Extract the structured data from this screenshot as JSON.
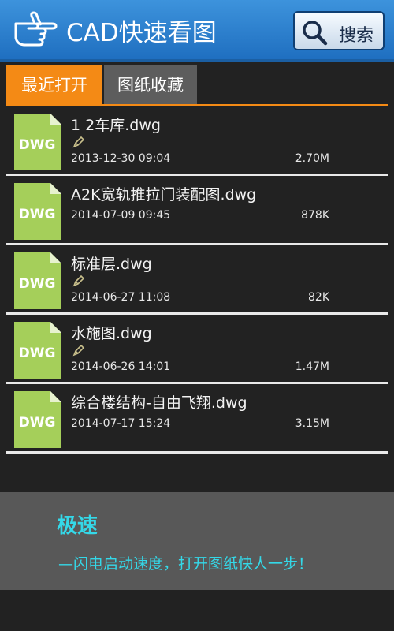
{
  "header": {
    "title": "CAD快速看图",
    "search_label": "搜索",
    "icons": {
      "logo": "pointing-hand-icon",
      "search": "magnifier-icon"
    }
  },
  "tabs": [
    {
      "label": "最近打开",
      "active": true
    },
    {
      "label": "图纸收藏",
      "active": false
    }
  ],
  "files": [
    {
      "name": "1 2车库.dwg",
      "date": "2013-12-30 09:04",
      "size": "2.70M",
      "edited": true,
      "icon_label": "DWG"
    },
    {
      "name": "A2K宽轨推拉门装配图.dwg",
      "date": "2014-07-09 09:45",
      "size": "878K",
      "edited": false,
      "icon_label": "DWG"
    },
    {
      "name": "标准层.dwg",
      "date": "2014-06-27 11:08",
      "size": "82K",
      "edited": true,
      "icon_label": "DWG"
    },
    {
      "name": "水施图.dwg",
      "date": "2014-06-26 14:01",
      "size": "1.47M",
      "edited": true,
      "icon_label": "DWG"
    },
    {
      "name": "综合楼结构-自由飞翔.dwg",
      "date": "2014-07-17 15:24",
      "size": "3.15M",
      "edited": false,
      "icon_label": "DWG"
    }
  ],
  "promo": {
    "title": "极速",
    "text": "—闪电启动速度，打开图纸快人一步！"
  },
  "colors": {
    "header_blue": "#2f83d0",
    "tab_active": "#f48a15",
    "tab_inactive": "#5d5d5d",
    "background": "#222222",
    "dwg_icon_green": "#a5cf5a",
    "promo_text": "#34d8e8"
  }
}
